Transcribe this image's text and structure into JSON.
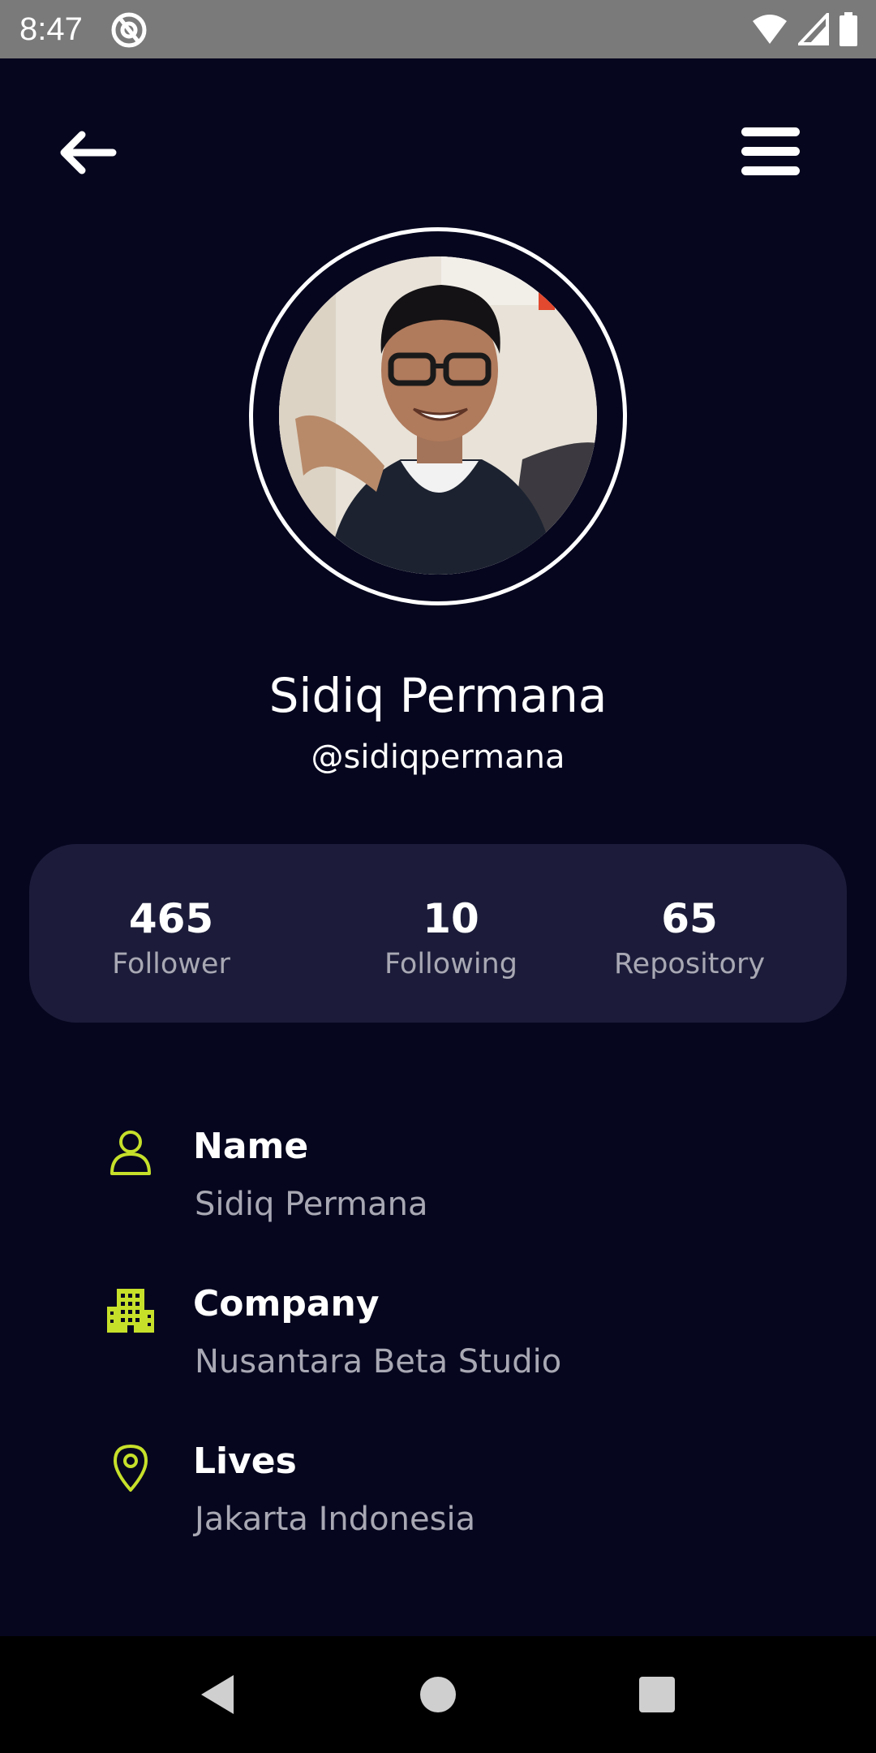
{
  "status_bar": {
    "time": "8:47"
  },
  "header": {
    "back_icon": "arrow-left-icon",
    "menu_icon": "hamburger-menu-icon"
  },
  "profile": {
    "name": "Sidiq Permana",
    "handle": "@sidiqpermana"
  },
  "stats": [
    {
      "value": "465",
      "label": "Follower"
    },
    {
      "value": "10",
      "label": "Following"
    },
    {
      "value": "65",
      "label": "Repository"
    }
  ],
  "details": [
    {
      "icon": "user-icon",
      "title": "Name",
      "value": "Sidiq Permana"
    },
    {
      "icon": "building-icon",
      "title": "Company",
      "value": "Nusantara Beta Studio"
    },
    {
      "icon": "location-pin-icon",
      "title": "Lives",
      "value": "Jakarta Indonesia"
    }
  ],
  "colors": {
    "background": "#06061f",
    "card": "#1c1c3a",
    "accent": "#c6e02a",
    "muted_text": "#a8a8b4"
  }
}
